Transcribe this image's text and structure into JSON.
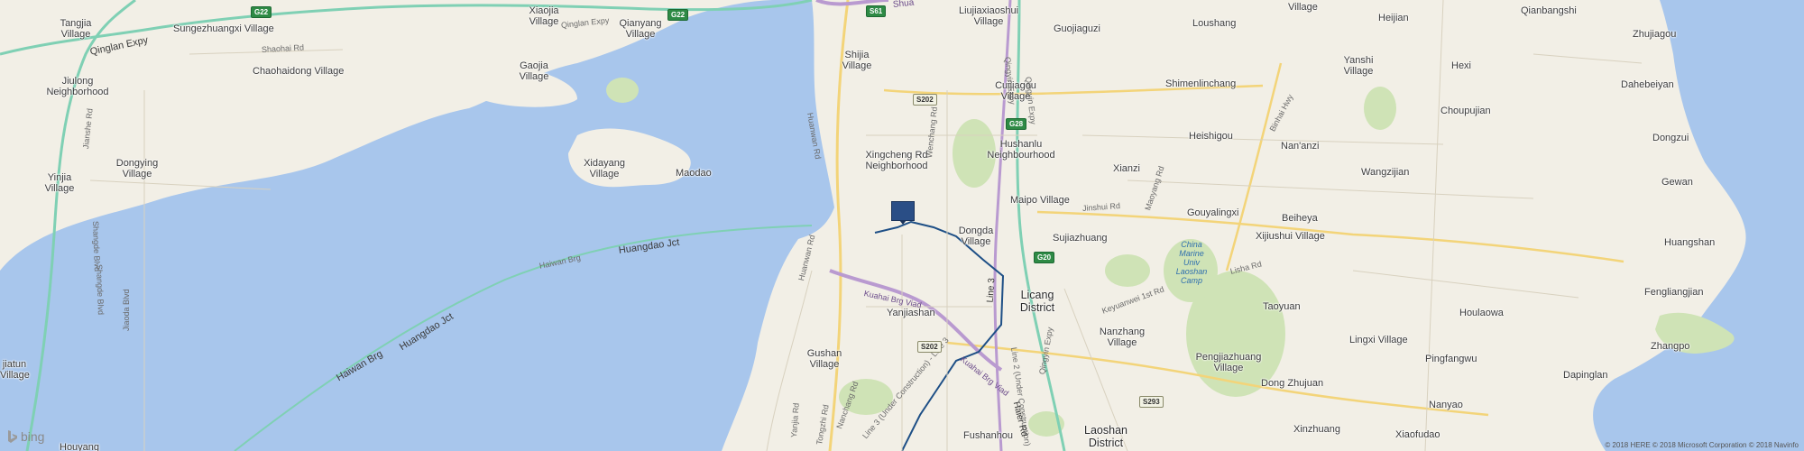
{
  "map": {
    "places": [
      {
        "id": "tangjia",
        "text": "Tangjia\nVillage"
      },
      {
        "id": "xiaojia",
        "text": "Xiaojia\nVillage"
      },
      {
        "id": "qianyang",
        "text": "Qianyang\nVillage"
      },
      {
        "id": "liujiaxiaoshui",
        "text": "Liujiaxiaoshui\nVillage"
      },
      {
        "id": "guojiaguzi",
        "text": "Guojiaguzi"
      },
      {
        "id": "loushang",
        "text": "Loushang"
      },
      {
        "id": "village-top",
        "text": "Village"
      },
      {
        "id": "heijian",
        "text": "Heijian"
      },
      {
        "id": "qianbangshi",
        "text": "Qianbangshi"
      },
      {
        "id": "sungezhuangxi",
        "text": "Sungezhuangxi Village"
      },
      {
        "id": "zhujiagou",
        "text": "Zhujiagou"
      },
      {
        "id": "chaohaidong",
        "text": "Chaohaidong Village"
      },
      {
        "id": "gaojia",
        "text": "Gaojia\nVillage"
      },
      {
        "id": "shijia",
        "text": "Shijia\nVillage"
      },
      {
        "id": "jiulong",
        "text": "Jiulong\nNeighborhood"
      },
      {
        "id": "shimenlinchang",
        "text": "Shimenlinchang"
      },
      {
        "id": "yanshi",
        "text": "Yanshi\nVillage"
      },
      {
        "id": "hexi",
        "text": "Hexi"
      },
      {
        "id": "dahebeiyan",
        "text": "Dahebeiyan"
      },
      {
        "id": "cuijiagou",
        "text": "Cuijiagou\nVillage"
      },
      {
        "id": "choupujian",
        "text": "Choupujian"
      },
      {
        "id": "dongying",
        "text": "Dongying\nVillage"
      },
      {
        "id": "hushanlu",
        "text": "Hushanlu\nNeighbourhood"
      },
      {
        "id": "heishigou",
        "text": "Heishigou"
      },
      {
        "id": "nananzi",
        "text": "Nan'anzi"
      },
      {
        "id": "dongzui",
        "text": "Dongzui"
      },
      {
        "id": "xidayang",
        "text": "Xidayang\nVillage"
      },
      {
        "id": "xingcheng",
        "text": "Xingcheng Rd\nNeighborhood"
      },
      {
        "id": "maodao",
        "text": "Maodao"
      },
      {
        "id": "xianzi",
        "text": "Xianzi"
      },
      {
        "id": "wangzijian",
        "text": "Wangzijian"
      },
      {
        "id": "yinjia",
        "text": "Yinjia\nVillage"
      },
      {
        "id": "gewan",
        "text": "Gewan"
      },
      {
        "id": "maipo",
        "text": "Maipo Village"
      },
      {
        "id": "gouyalingxi",
        "text": "Gouyalingxi"
      },
      {
        "id": "beiheya",
        "text": "Beiheya"
      },
      {
        "id": "dongda",
        "text": "Dongda\nVillage"
      },
      {
        "id": "sujiazhuang",
        "text": "Sujiazhuang"
      },
      {
        "id": "xijiushui",
        "text": "Xijiushui Village"
      },
      {
        "id": "huangshan",
        "text": "Huangshan"
      },
      {
        "id": "licang",
        "text": "Licang\nDistrict"
      },
      {
        "id": "yanjiashan",
        "text": "Yanjiashan"
      },
      {
        "id": "taoyuan",
        "text": "Taoyuan"
      },
      {
        "id": "fengliangjian",
        "text": "Fengliangjian"
      },
      {
        "id": "houlaowa",
        "text": "Houlaowa"
      },
      {
        "id": "nanzhang",
        "text": "Nanzhang\nVillage"
      },
      {
        "id": "lingxi",
        "text": "Lingxi Village"
      },
      {
        "id": "zhangpo",
        "text": "Zhangpo"
      },
      {
        "id": "gushan",
        "text": "Gushan\nVillage"
      },
      {
        "id": "pengjiazhuang",
        "text": "Pengjiazhuang\nVillage"
      },
      {
        "id": "pingfangwu",
        "text": "Pingfangwu"
      },
      {
        "id": "dapinglan",
        "text": "Dapinglan"
      },
      {
        "id": "jiatun",
        "text": "jiatun\nVillage"
      },
      {
        "id": "dongzhujuan",
        "text": "Dong Zhujuan"
      },
      {
        "id": "nanyao",
        "text": "Nanyao"
      },
      {
        "id": "xinzhuang",
        "text": "Xinzhuang"
      },
      {
        "id": "fushanhou",
        "text": "Fushanhou"
      },
      {
        "id": "laoshan",
        "text": "Laoshan\nDistrict"
      },
      {
        "id": "xiaofudao",
        "text": "Xiaofudao"
      },
      {
        "id": "houyang",
        "text": "Houyang"
      }
    ],
    "roads": [
      {
        "id": "qinglan-expy-1",
        "text": "Qinglan Expy",
        "purple": false
      },
      {
        "id": "qinglan-expy-2",
        "text": "Qinglan Expy",
        "purple": false
      },
      {
        "id": "shaohai-rd",
        "text": "Shaohai Rd",
        "purple": false
      },
      {
        "id": "jianshe-rd",
        "text": "Jianshe Rd",
        "purple": false
      },
      {
        "id": "shangde-blvd-1",
        "text": "Shangde Blvd",
        "purple": false
      },
      {
        "id": "shangde-blvd-2",
        "text": "Shangde Blvd",
        "purple": false
      },
      {
        "id": "jiaoda-blvd",
        "text": "Jiaoda Blvd",
        "purple": false
      },
      {
        "id": "huanwan-rd-1",
        "text": "Huanwan Rd",
        "purple": false
      },
      {
        "id": "huanwan-rd-2",
        "text": "Huanwan Rd",
        "purple": false
      },
      {
        "id": "wenchang-rd",
        "text": "Wenchang Rd",
        "purple": false
      },
      {
        "id": "qingyin-expy-1",
        "text": "Qingyin Expy",
        "purple": false
      },
      {
        "id": "qingyin-expy-2",
        "text": "Qingyin Expy",
        "purple": false
      },
      {
        "id": "binhai-hwy",
        "text": "Binhai Hwy",
        "purple": false
      },
      {
        "id": "jinshui-rd",
        "text": "Jinshui Rd",
        "purple": false
      },
      {
        "id": "maoyang-rd",
        "text": "Maoyang Rd",
        "purple": false
      },
      {
        "id": "lisha-rd",
        "text": "Lisha Rd",
        "purple": false
      },
      {
        "id": "keyuanwei-rd",
        "text": "Keyuanwei 1st Rd",
        "purple": false
      },
      {
        "id": "haiwan-brg-1",
        "text": "Haiwan Brg",
        "purple": false
      },
      {
        "id": "haiwan-brg-2",
        "text": "Haiwan Brg",
        "purple": false
      },
      {
        "id": "huangdao-jct-1",
        "text": "Huangdao Jct",
        "purple": false
      },
      {
        "id": "huangdao-jct-2",
        "text": "Huangdao Jct",
        "purple": false
      },
      {
        "id": "line-3",
        "text": "Line 3",
        "purple": false
      },
      {
        "id": "line-2",
        "text": "Line 2 (Under Construction)",
        "purple": false
      },
      {
        "id": "line-3-uc",
        "text": "Line 3 (Under Construction) - Line 3",
        "purple": false
      },
      {
        "id": "haier-rd",
        "text": "Haier Rd",
        "purple": false
      },
      {
        "id": "kuahai-brg-1",
        "text": "Kuahai Brg Viad",
        "purple": true
      },
      {
        "id": "kuahai-brg-2",
        "text": "Kuahai Brg Viad",
        "purple": true
      },
      {
        "id": "shuang",
        "text": "Shua",
        "purple": true
      },
      {
        "id": "yanjia-rd",
        "text": "Yanjia Rd",
        "purple": false
      },
      {
        "id": "nanchang-rd",
        "text": "Nanchang Rd",
        "purple": false
      },
      {
        "id": "tongzhi-rd",
        "text": "Tongzhi Rd",
        "purple": false
      },
      {
        "id": "qingyin-expy-3",
        "text": "Qingyin Expy",
        "purple": false
      }
    ],
    "shields": [
      {
        "id": "g22-a",
        "text": "G22",
        "color": "green"
      },
      {
        "id": "g22-b",
        "text": "G22",
        "color": "green"
      },
      {
        "id": "s61",
        "text": "S61",
        "color": "green"
      },
      {
        "id": "s202-a",
        "text": "S202",
        "color": "yellow"
      },
      {
        "id": "s202-b",
        "text": "S202",
        "color": "yellow"
      },
      {
        "id": "g28",
        "text": "G28",
        "color": "green"
      },
      {
        "id": "g20",
        "text": "G20",
        "color": "green"
      },
      {
        "id": "s293",
        "text": "S293",
        "color": "yellow"
      }
    ],
    "water_labels": [
      {
        "id": "marine-univ",
        "text": "China\nMarine\nUniv\nLaoshan\nCamp"
      }
    ],
    "branding": {
      "logo": "bing"
    },
    "copyright": "© 2018 HERE © 2018 Microsoft Corporation © 2018 Navinfo"
  },
  "colors": {
    "land": "#f2efe6",
    "water": "#a8c6ec",
    "park": "#cfe3b6",
    "expressway": "#7fd0b4",
    "highway": "#f3d479",
    "purple_route": "#b99ad0",
    "metro": "#1e4f86",
    "marker": "#2a4e86"
  },
  "icons": {
    "marker": "map-pin-icon"
  }
}
